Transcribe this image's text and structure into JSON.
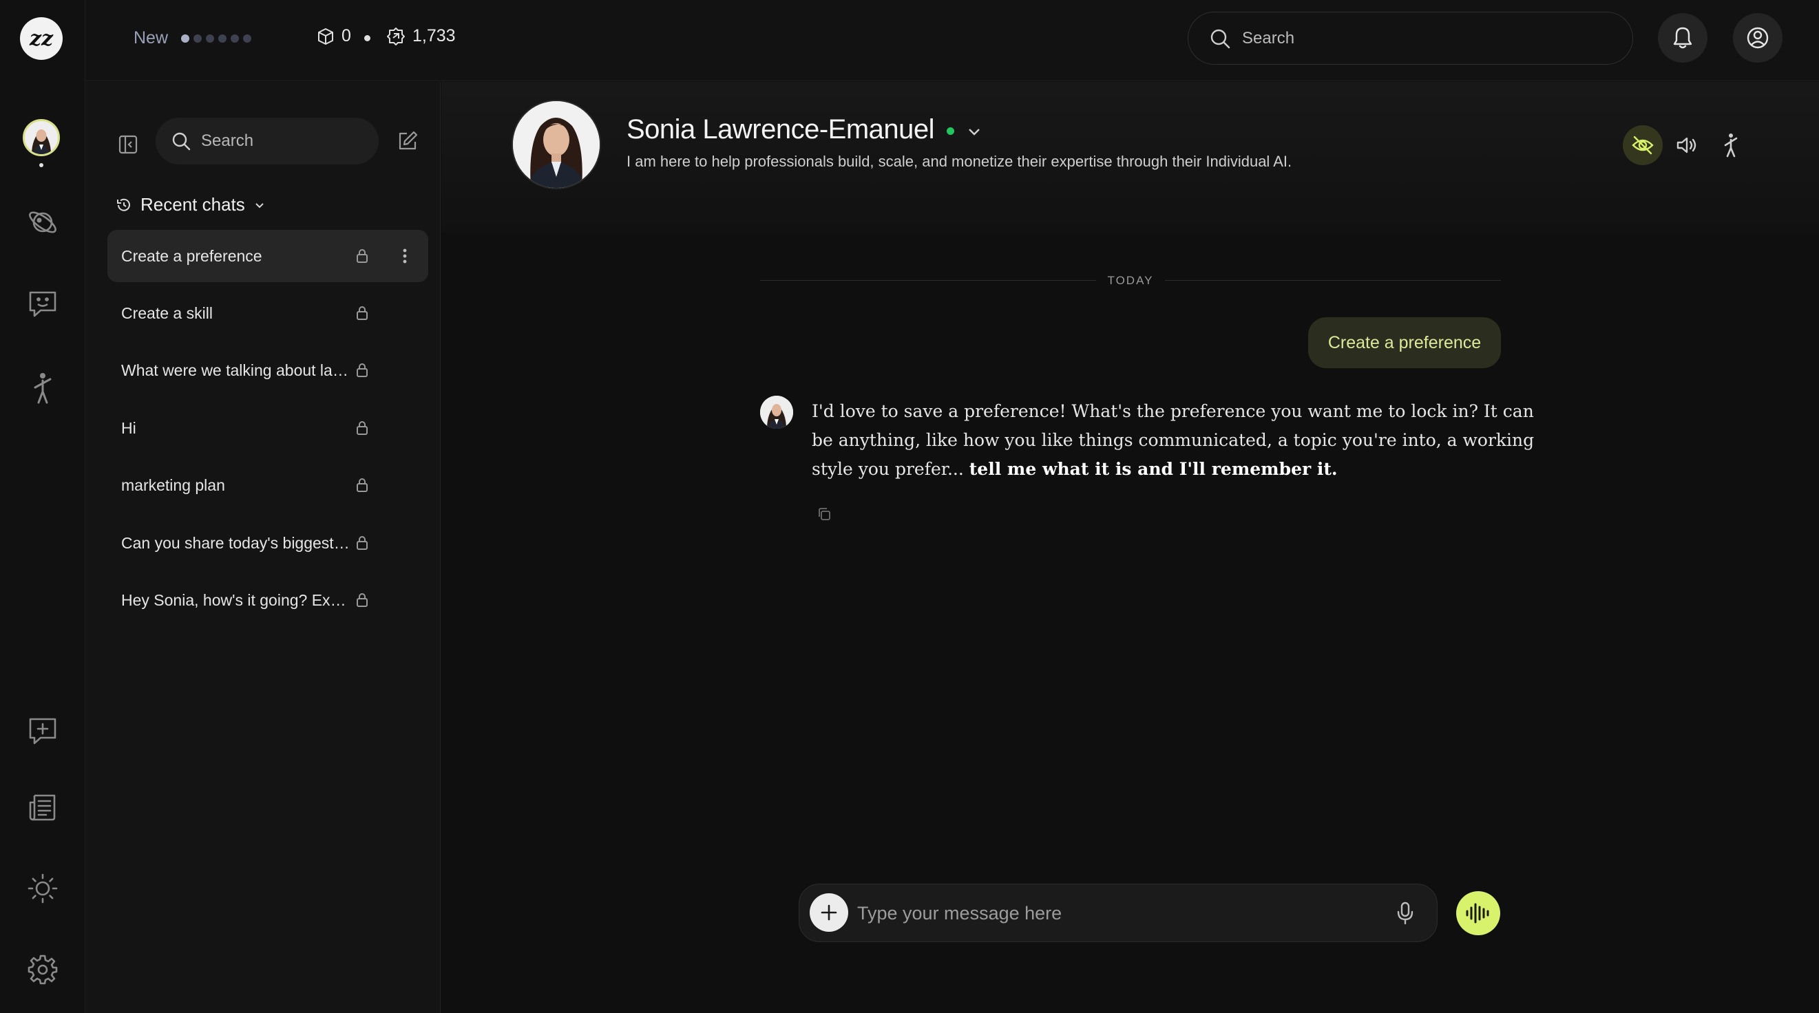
{
  "topbar": {
    "new_label": "New",
    "progress_dots": {
      "total": 6,
      "filled": 1
    },
    "credits": "0",
    "points": "1,733",
    "search_placeholder": "Search"
  },
  "rail": {
    "logo_text": "zz",
    "nav_items": [
      "avatar",
      "planet-icon",
      "chat-face-icon",
      "figure-icon",
      "add-chat-icon",
      "newspaper-icon",
      "sun-icon",
      "gear-icon"
    ]
  },
  "chat_panel": {
    "search_placeholder": "Search",
    "recent_label": "Recent chats",
    "chats": [
      {
        "title": "Create a preference",
        "active": true
      },
      {
        "title": "Create a skill"
      },
      {
        "title": "What were we talking about last time?"
      },
      {
        "title": "Hi"
      },
      {
        "title": "marketing plan"
      },
      {
        "title": "Can you share today's biggest news?"
      },
      {
        "title": "Hey Sonia, how's it going? Excited to chat"
      }
    ]
  },
  "profile": {
    "name": "Sonia Lawrence-Emanuel",
    "status": "online",
    "bio": "I am here to help professionals build, scale, and monetize their expertise through their Individual AI."
  },
  "conversation": {
    "date_divider": "TODAY",
    "user_message": "Create a preference",
    "assistant_message_plain": "I'd love to save a preference! What's the preference you want me to lock in? It can be anything, like how you like things communicated, a topic you're into, a working style you prefer... ",
    "assistant_message_bold": "tell me what it is and I'll remember it."
  },
  "composer": {
    "placeholder": "Type your message here"
  },
  "colors": {
    "accent": "#d9f26b",
    "bubble_bg": "#2b2d1f",
    "bubble_text": "#dde89a",
    "online": "#22c55e",
    "background": "#0f0f0f"
  }
}
